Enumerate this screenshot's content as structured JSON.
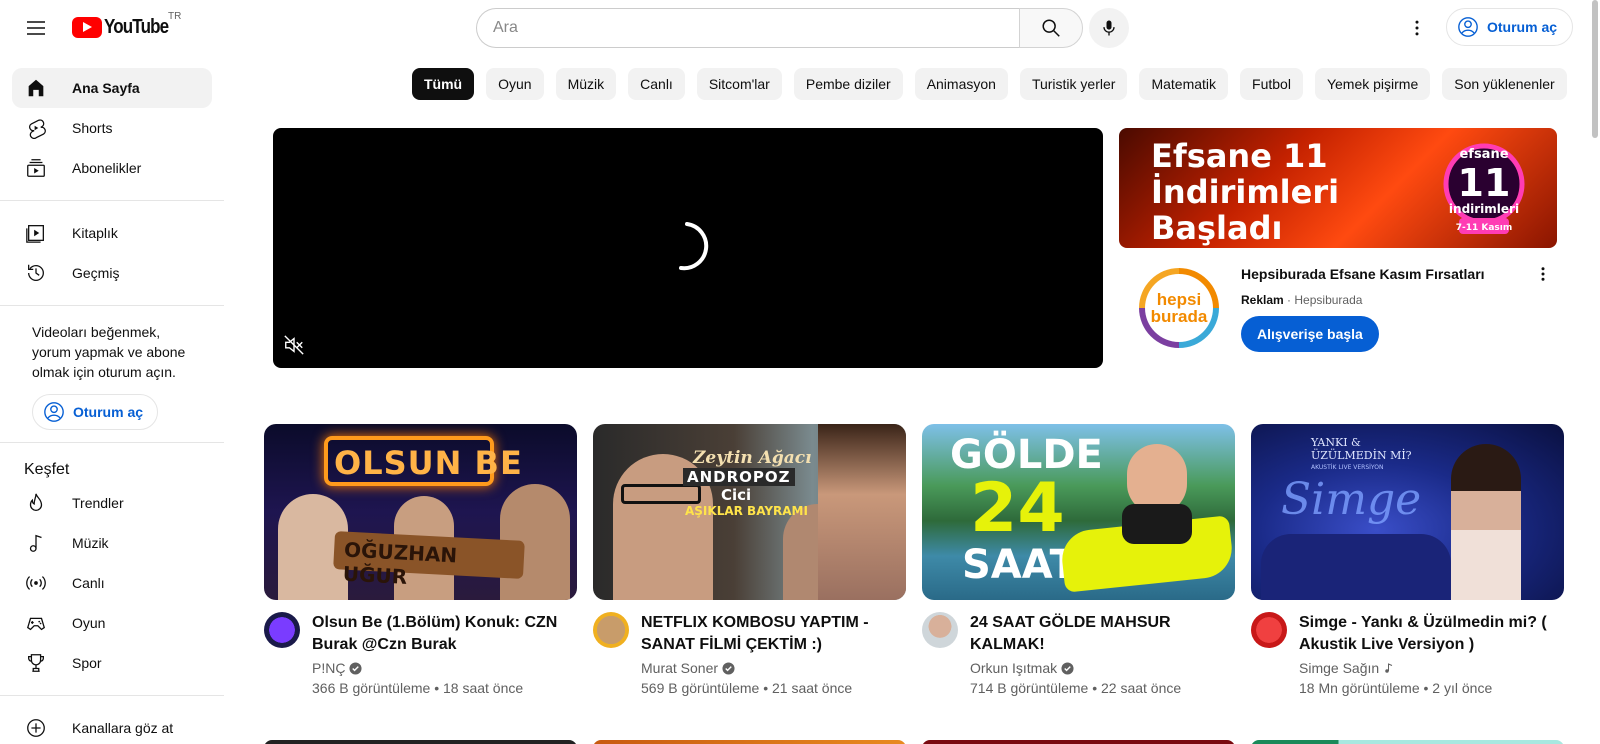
{
  "header": {
    "logo_text": "YouTube",
    "country_code": "TR",
    "search_placeholder": "Ara",
    "signin_label": "Oturum aç"
  },
  "sidebar": {
    "main_items": [
      {
        "label": "Ana Sayfa",
        "icon": "home-icon",
        "active": true
      },
      {
        "label": "Shorts",
        "icon": "shorts-icon"
      },
      {
        "label": "Abonelikler",
        "icon": "subscriptions-icon"
      }
    ],
    "library_items": [
      {
        "label": "Kitaplık",
        "icon": "library-icon"
      },
      {
        "label": "Geçmiş",
        "icon": "history-icon"
      }
    ],
    "signin_prompt": "Videoları beğenmek, yorum yapmak ve abone olmak için oturum açın.",
    "signin_label": "Oturum aç",
    "explore_heading": "Keşfet",
    "explore_items": [
      {
        "label": "Trendler",
        "icon": "trending-icon"
      },
      {
        "label": "Müzik",
        "icon": "music-icon"
      },
      {
        "label": "Canlı",
        "icon": "live-icon"
      },
      {
        "label": "Oyun",
        "icon": "gaming-icon"
      },
      {
        "label": "Spor",
        "icon": "sports-icon"
      }
    ],
    "browse_channels": "Kanallara göz at"
  },
  "chips": [
    "Tümü",
    "Oyun",
    "Müzik",
    "Canlı",
    "Sitcom'lar",
    "Pembe diziler",
    "Animasyon",
    "Turistik yerler",
    "Matematik",
    "Futbol",
    "Yemek pişirme",
    "Son yüklenenler"
  ],
  "ad": {
    "banner_text_line1": "Efsane 11",
    "banner_text_line2": "İndirimleri",
    "banner_text_line3": "Başladı",
    "badge_top": "efsane",
    "badge_number": "11",
    "badge_sub": "indirimleri",
    "badge_dates": "7-11 Kasım",
    "logo_line1": "hepsi",
    "logo_line2": "burada",
    "title": "Hepsiburada Efsane Kasım Fırsatları",
    "sponsored": "Reklam",
    "advertiser": "Hepsiburada",
    "cta": "Alışverişe başla"
  },
  "videos": [
    {
      "title": "Olsun Be (1.Bölüm) Konuk: CZN Burak @Czn Burak",
      "channel": "P!NÇ",
      "verified": true,
      "stats": "366 B görüntüleme • 18 saat önce",
      "thumb_text": "OLSUN BE",
      "thumb_sub": "OĞUZHAN UĞUR"
    },
    {
      "title": "NETFLIX KOMBOSU YAPTIM - SANAT FİLMİ ÇEKTİM :)",
      "channel": "Murat Soner",
      "verified": true,
      "stats": "569 B görüntüleme • 21 saat önce",
      "thumb_text": "Zeytin Ağacı",
      "thumb_sub": "ANDROPOZ",
      "thumb_sub2": "Cici",
      "thumb_sub3": "AŞIKLAR BAYRAMI"
    },
    {
      "title": "24 SAAT GÖLDE MAHSUR KALMAK!",
      "channel": "Orkun Işıtmak",
      "verified": true,
      "stats": "714 B görüntüleme • 22 saat önce",
      "thumb_text": "GÖLDE",
      "thumb_sub": "24",
      "thumb_sub2": "SAAT"
    },
    {
      "title": "Simge - Yankı & Üzülmedin mi? ( Akustik Live Versiyon )",
      "channel": "Simge Sağın",
      "verified": false,
      "music": true,
      "stats": "18 Mn görüntüleme • 2 yıl önce",
      "thumb_text": "YANKI & ÜZÜLMEDİN Mİ?",
      "thumb_sub": "AKUSTİK LIVE VERSİYON",
      "thumb_sub2": "Simge"
    }
  ],
  "colors": {
    "brand_red": "#ff0000",
    "link_blue": "#065fd4",
    "chip_bg": "#f2f2f2"
  }
}
